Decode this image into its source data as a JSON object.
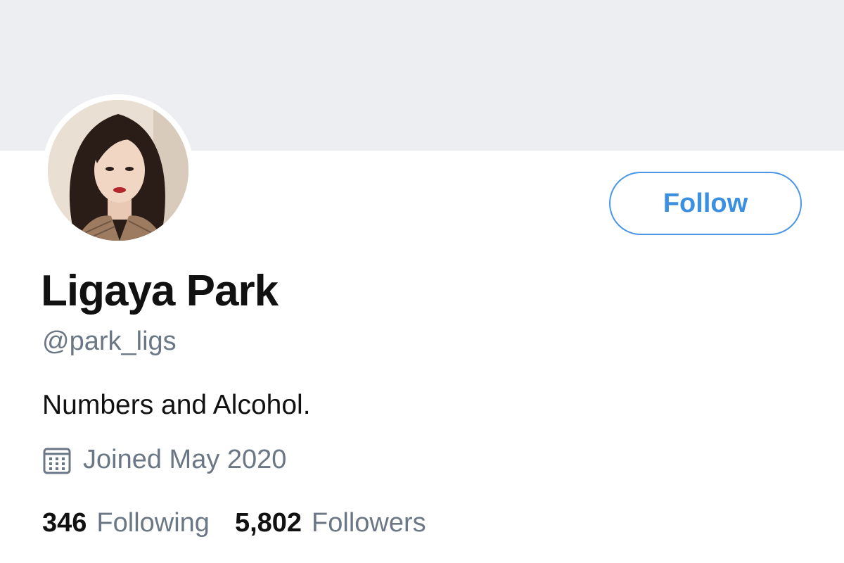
{
  "profile": {
    "name": "Ligaya Park",
    "handle": "@park_ligs",
    "bio": "Numbers and Alcohol.",
    "joined": "Joined May 2020",
    "follow_label": "Follow"
  },
  "stats": {
    "following_count": "346",
    "following_label": "Following",
    "followers_count": "5,802",
    "followers_label": "Followers"
  },
  "icons": {
    "calendar": "calendar-icon"
  },
  "colors": {
    "accent": "#3d8fe0",
    "banner": "#edeef1",
    "secondary_text": "#6b7785",
    "primary_text": "#111111"
  }
}
